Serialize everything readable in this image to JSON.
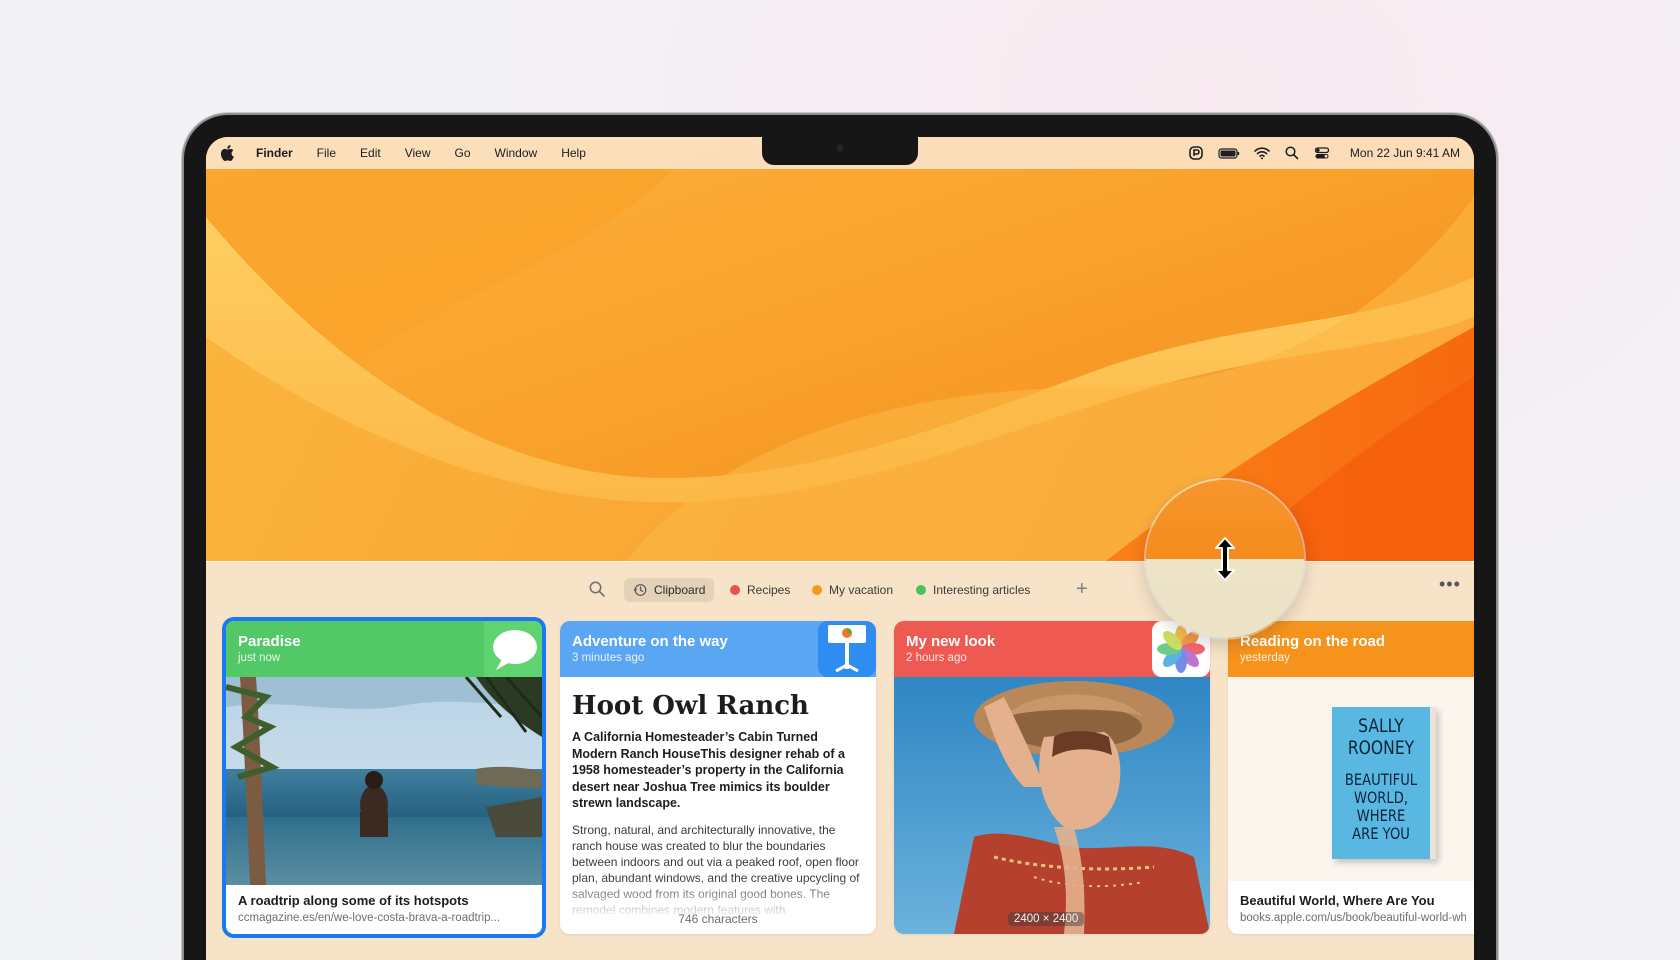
{
  "menubar": {
    "app_name": "Finder",
    "menus": [
      "File",
      "Edit",
      "View",
      "Go",
      "Window",
      "Help"
    ],
    "clock": "Mon 22 Jun  9:41 AM",
    "status_icons": [
      "paste-app-icon",
      "battery-icon",
      "wifi-icon",
      "search-icon",
      "control-center-icon"
    ]
  },
  "toolbar": {
    "tabs": [
      {
        "label": "Clipboard",
        "icon": "clock-icon",
        "active": true
      },
      {
        "label": "Recipes",
        "color": "#e9524a"
      },
      {
        "label": "My vacation",
        "color": "#f39a1e"
      },
      {
        "label": "Interesting articles",
        "color": "#4cc159"
      }
    ]
  },
  "cards": [
    {
      "title": "Paradise",
      "subtitle": "just now",
      "color": "#52c966",
      "app_icon": "messages-icon",
      "footer_title": "A roadtrip along some of its hotspots",
      "footer_url": "ccmagazine.es/en/we-love-costa-brava-a-roadtrip..."
    },
    {
      "title": "Adventure on the way",
      "subtitle": "3 minutes ago",
      "color": "#5aa6f2",
      "app_icon": "keynote-icon",
      "article_title": "Hoot Owl Ranch",
      "article_lead": "A California Homesteader’s Cabin Turned Modern Ranch HouseThis designer rehab of a 1958 homesteader’s property in the California desert near Joshua Tree mimics its boulder strewn landscape.",
      "article_body": "Strong, natural, and architecturally innovative, the ranch house was created to blur the boundaries between indoors and out via a peaked roof, open floor plan, abundant windows, and the creative upcycling of salvaged wood from its original good bones. The remodel combines modern features with",
      "char_count": "746 characters"
    },
    {
      "title": "My new look",
      "subtitle": "2 hours ago",
      "color": "#ee5a51",
      "app_icon": "photos-icon",
      "dimensions": "2400 × 2400"
    },
    {
      "title": "Reading on the road",
      "subtitle": "yesterday",
      "color": "#f6931c",
      "app_icon": "books-icon",
      "book_cover": {
        "top_line": "SALLY",
        "author": "ROONEY",
        "title_lines": [
          "BEAUTIFUL",
          "WORLD,",
          "WHERE",
          "ARE YOU"
        ]
      },
      "footer_title": "Beautiful World, Where Are You",
      "footer_url": "books.apple.com/us/book/beautiful-world-where..."
    }
  ]
}
